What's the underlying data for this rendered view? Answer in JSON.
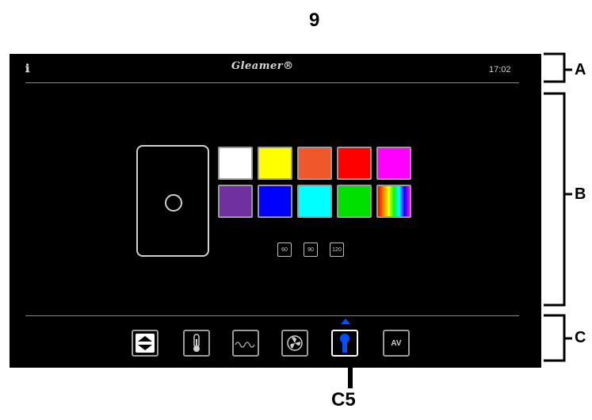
{
  "callouts": {
    "top": "9",
    "bottom": "C5",
    "section_a": "A",
    "section_b": "B",
    "section_c": "C"
  },
  "header": {
    "brand": "Gleamer®",
    "time": "17:02"
  },
  "colors": {
    "swatches": [
      "#ffffff",
      "#ffff00",
      "#f0572a",
      "#ff0000",
      "#ff00ff",
      "#7030a0",
      "#0000ff",
      "#00ffff",
      "#00e000",
      "rainbow"
    ],
    "active_nav": "#0050ff"
  },
  "speed_buttons": [
    "60",
    "90",
    "120"
  ],
  "nav": [
    {
      "icon": "up-down-arrows-icon"
    },
    {
      "icon": "thermometer-icon"
    },
    {
      "icon": "wave-icon"
    },
    {
      "icon": "fan-icon"
    },
    {
      "icon": "light-icon",
      "active": true
    },
    {
      "icon": "av-icon",
      "label": "AV"
    }
  ]
}
